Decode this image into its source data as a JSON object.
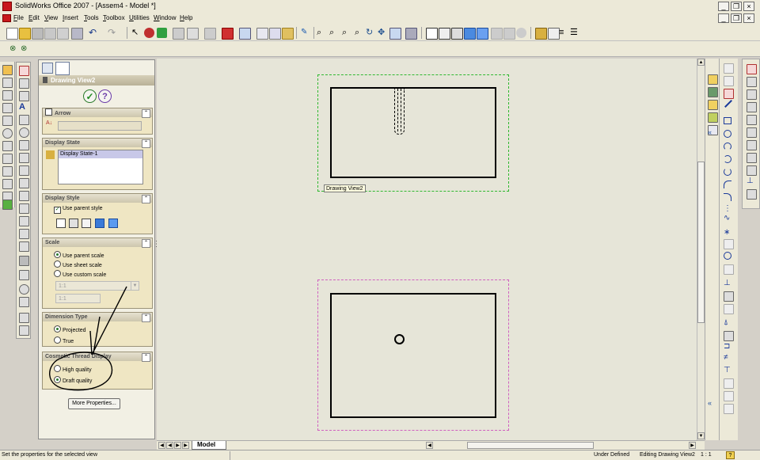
{
  "window": {
    "title": "SolidWorks Office 2007 - [Assem4 - Model *]",
    "min_glyph": "_",
    "restore_glyph": "❐",
    "close_glyph": "×"
  },
  "menu": {
    "items": [
      "File",
      "Edit",
      "View",
      "Insert",
      "Tools",
      "Toolbox",
      "Utilities",
      "Window",
      "Help"
    ]
  },
  "panel": {
    "title": "Drawing View2",
    "arrow_group": "Arrow",
    "arrow_label_text": "",
    "display_state_group": "Display State",
    "display_state_item": "Display State-1",
    "display_style_group": "Display Style",
    "use_parent_style": "Use parent style",
    "scale_group": "Scale",
    "use_parent_scale": "Use parent scale",
    "use_sheet_scale": "Use sheet scale",
    "use_custom_scale": "Use custom scale",
    "scale_select_value": "1:1",
    "scale_input_value": "1:1",
    "dimension_type_group": "Dimension Type",
    "projected": "Projected",
    "true_label": "True",
    "cosmetic_thread_group": "Cosmetic Thread Display",
    "high_quality": "High quality",
    "draft_quality": "Draft quality",
    "more_properties": "More Properties..."
  },
  "canvas": {
    "view_label": "Drawing View2"
  },
  "tabs": {
    "model": "Model"
  },
  "status": {
    "message": "Set the properties for the selected view",
    "under_defined": "Under Defined",
    "editing": "Editing Drawing View2",
    "scale": "1 : 1",
    "help_glyph": "?"
  },
  "colors": {
    "accent_green": "#1f8a1f",
    "help_purple": "#6a3aa8",
    "view_border_green": "#2fb82f",
    "view_border_pink": "#d060c0",
    "panel_group_bg": "#efe6c3"
  }
}
